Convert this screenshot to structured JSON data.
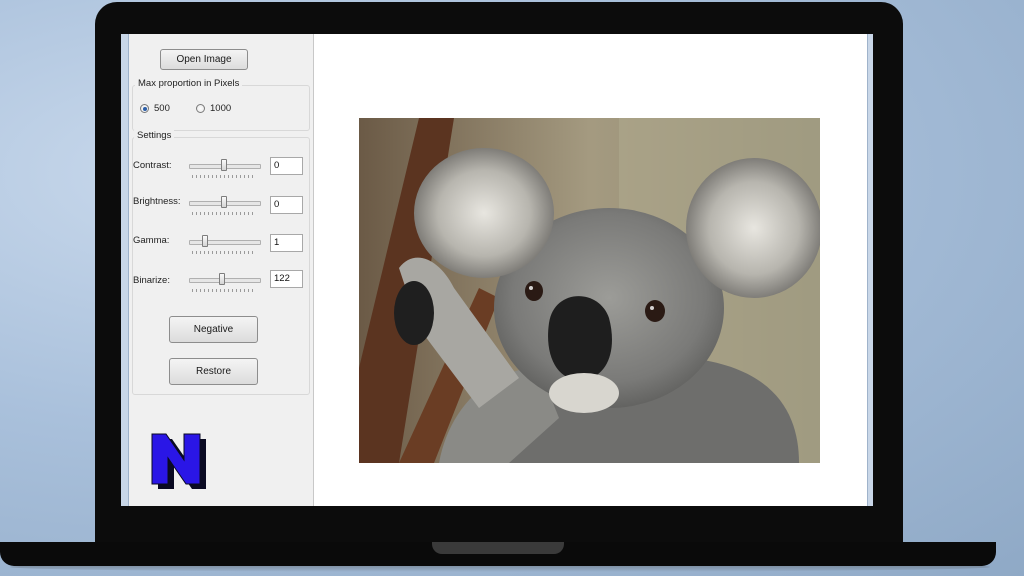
{
  "app": {
    "open_image_label": "Open Image",
    "max_proportion": {
      "title": "Max proportion in Pixels",
      "options": [
        "500",
        "1000"
      ],
      "selected": "500"
    },
    "settings": {
      "title": "Settings",
      "contrast": {
        "label": "Contrast:",
        "value": "0"
      },
      "brightness": {
        "label": "Brightness:",
        "value": "0"
      },
      "gamma": {
        "label": "Gamma:",
        "value": "1"
      },
      "binarize": {
        "label": "Binarize:",
        "value": "122"
      }
    },
    "negative_label": "Negative",
    "restore_label": "Restore",
    "logo_letter": "N",
    "image_subject": "koala-photo"
  },
  "colors": {
    "logo_fill": "#2a16e6",
    "logo_shadow": "#0a0a22",
    "radio_accent": "#2b5ea8"
  }
}
